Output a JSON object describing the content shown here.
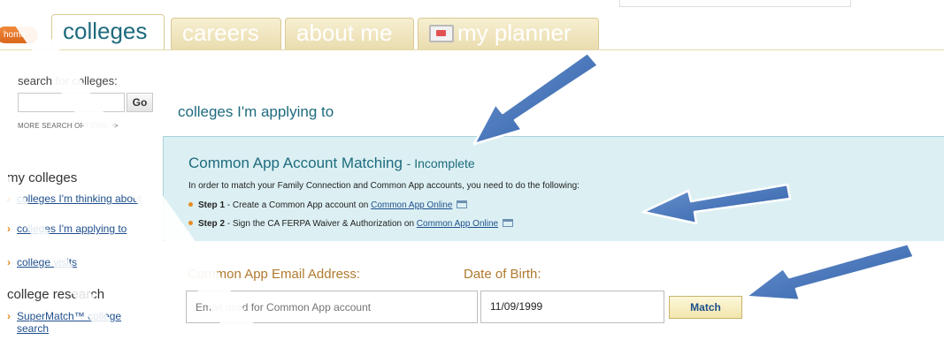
{
  "nav": {
    "home_label": "home",
    "tabs": [
      {
        "label": "colleges"
      },
      {
        "label": "careers"
      },
      {
        "label": "about me"
      },
      {
        "label": "my planner"
      }
    ]
  },
  "sidebar": {
    "search_title": "search for colleges:",
    "search_placeholder": "",
    "go_label": "Go",
    "more_options": "MORE SEARCH OPTIONS >>",
    "my_colleges_heading": "my colleges",
    "my_colleges_links": [
      {
        "label": "colleges I'm thinking about"
      },
      {
        "label": "colleges I'm applying to"
      },
      {
        "label": "college visits"
      }
    ],
    "research_heading": "college research",
    "research_links": [
      {
        "label": "SuperMatch™ college search"
      }
    ]
  },
  "main": {
    "page_title": "colleges I'm applying to",
    "account_matching": {
      "title": "Common App Account Matching",
      "status": "- Incomplete",
      "intro": "In order to match your Family Connection and Common App accounts, you need to do the following:",
      "steps": [
        {
          "label": "Step 1",
          "text": " - Create a Common App account on ",
          "link": "Common App Online"
        },
        {
          "label": "Step 2",
          "text": " - Sign the CA FERPA Waiver & Authorization on ",
          "link": "Common App Online"
        }
      ]
    },
    "form": {
      "email_label": "Common App Email Address:",
      "dob_label": "Date of Birth:",
      "email_placeholder": "Email used for Common App account",
      "dob_value": "11/09/1999",
      "match_label": "Match"
    }
  },
  "colors": {
    "accent_teal": "#1e6b7d",
    "panel_bg": "#dcf0f3",
    "label_orange": "#b07a2e",
    "arrow_blue": "#3f6fb5"
  }
}
